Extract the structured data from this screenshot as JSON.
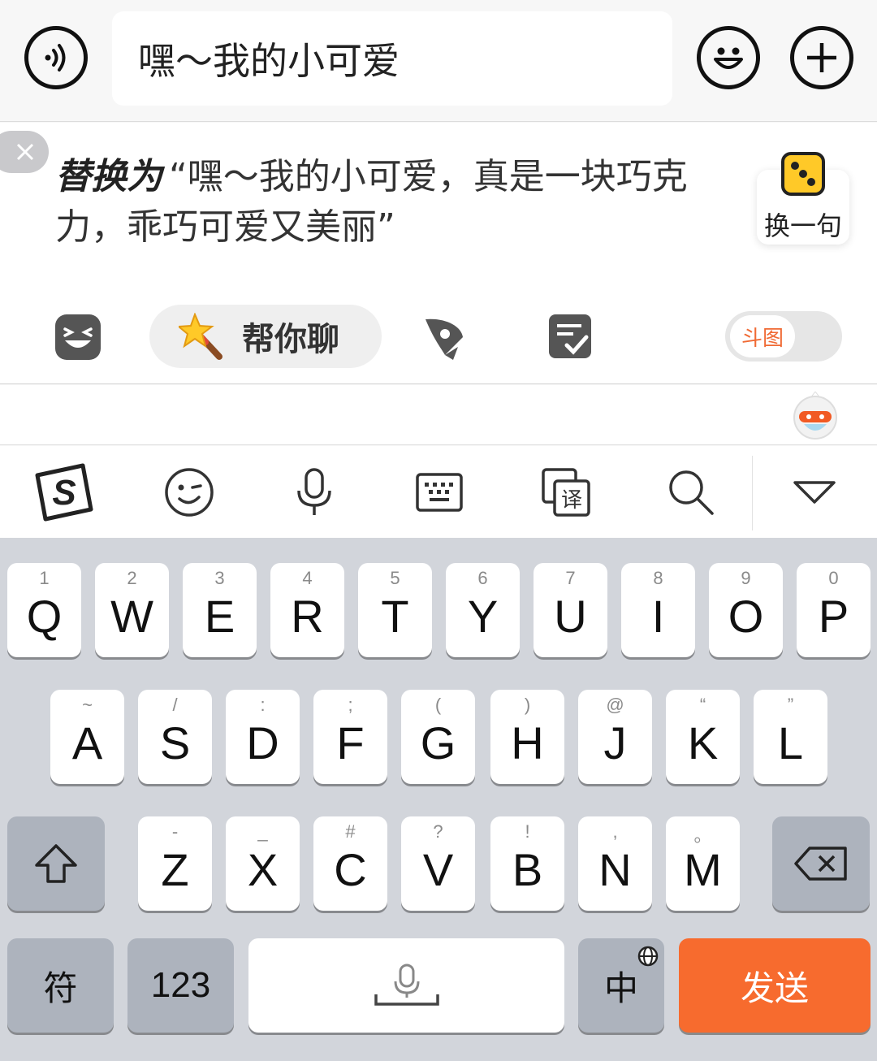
{
  "top_bar": {
    "input_text": "嘿～我的小可爱",
    "icons": {
      "voice": "voice-icon",
      "emoji": "smiley-icon",
      "plus": "plus-icon"
    }
  },
  "suggestion": {
    "lead": "替换为",
    "text": "“嘿～我的小可爱，真是一块巧克力，乖巧可爱又美丽”",
    "shuffle_label": "换一句",
    "tools": {
      "help_chat_label": "帮你聊",
      "toggle_label": "斗图"
    }
  },
  "ime_toolbar": {
    "icons": [
      "sogou-logo-icon",
      "emoji-wink-icon",
      "microphone-icon",
      "keyboard-icon",
      "translate-icon",
      "search-icon",
      "collapse-icon"
    ],
    "translate_char": "译",
    "logo_char": "S"
  },
  "keyboard": {
    "row1": [
      {
        "key": "Q",
        "hint": "1"
      },
      {
        "key": "W",
        "hint": "2"
      },
      {
        "key": "E",
        "hint": "3"
      },
      {
        "key": "R",
        "hint": "4"
      },
      {
        "key": "T",
        "hint": "5"
      },
      {
        "key": "Y",
        "hint": "6"
      },
      {
        "key": "U",
        "hint": "7"
      },
      {
        "key": "I",
        "hint": "8"
      },
      {
        "key": "O",
        "hint": "9"
      },
      {
        "key": "P",
        "hint": "0"
      }
    ],
    "row2": [
      {
        "key": "A",
        "hint": "~"
      },
      {
        "key": "S",
        "hint": "/"
      },
      {
        "key": "D",
        "hint": ":"
      },
      {
        "key": "F",
        "hint": ";"
      },
      {
        "key": "G",
        "hint": "("
      },
      {
        "key": "H",
        "hint": ")"
      },
      {
        "key": "J",
        "hint": "@"
      },
      {
        "key": "K",
        "hint": "“"
      },
      {
        "key": "L",
        "hint": "”"
      }
    ],
    "row3": [
      {
        "key": "Z",
        "hint": "-"
      },
      {
        "key": "X",
        "hint": "_"
      },
      {
        "key": "C",
        "hint": "#"
      },
      {
        "key": "V",
        "hint": "?"
      },
      {
        "key": "B",
        "hint": "!"
      },
      {
        "key": "N",
        "hint": ","
      },
      {
        "key": "M",
        "hint": "。"
      }
    ],
    "symbols_label": "符",
    "numbers_label": "123",
    "language_label": "中",
    "send_label": "发送"
  },
  "colors": {
    "accent_orange": "#f76b2e",
    "keyboard_bg": "#d2d5db",
    "key_gray": "#adb3bd"
  }
}
